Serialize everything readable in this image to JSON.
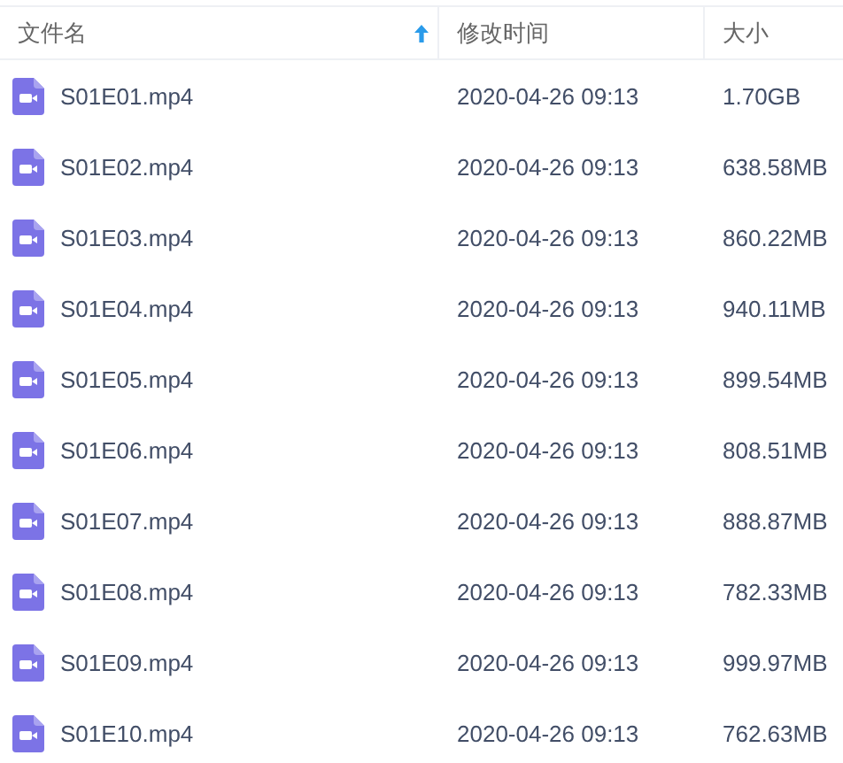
{
  "columns": [
    {
      "label": "文件名",
      "sorted": true
    },
    {
      "label": "修改时间",
      "sorted": false
    },
    {
      "label": "大小",
      "sorted": false
    }
  ],
  "rows": [
    {
      "name": "S01E01.mp4",
      "modified": "2020-04-26 09:13",
      "size": "1.70GB"
    },
    {
      "name": "S01E02.mp4",
      "modified": "2020-04-26 09:13",
      "size": "638.58MB"
    },
    {
      "name": "S01E03.mp4",
      "modified": "2020-04-26 09:13",
      "size": "860.22MB"
    },
    {
      "name": "S01E04.mp4",
      "modified": "2020-04-26 09:13",
      "size": "940.11MB"
    },
    {
      "name": "S01E05.mp4",
      "modified": "2020-04-26 09:13",
      "size": "899.54MB"
    },
    {
      "name": "S01E06.mp4",
      "modified": "2020-04-26 09:13",
      "size": "808.51MB"
    },
    {
      "name": "S01E07.mp4",
      "modified": "2020-04-26 09:13",
      "size": "888.87MB"
    },
    {
      "name": "S01E08.mp4",
      "modified": "2020-04-26 09:13",
      "size": "782.33MB"
    },
    {
      "name": "S01E09.mp4",
      "modified": "2020-04-26 09:13",
      "size": "999.97MB"
    },
    {
      "name": "S01E10.mp4",
      "modified": "2020-04-26 09:13",
      "size": "762.63MB"
    }
  ]
}
